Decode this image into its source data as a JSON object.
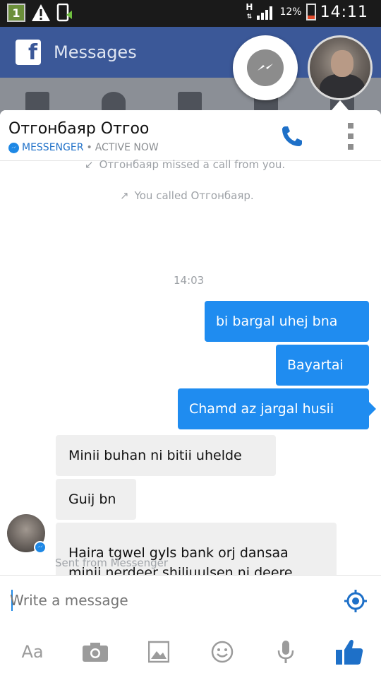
{
  "status_bar": {
    "notification_count": "1",
    "network_label": "H",
    "battery_percent": "12%",
    "time": "14:11"
  },
  "app_bar": {
    "title": "Messages"
  },
  "chat_header": {
    "contact_name": "Отгонбаяр Отгоо",
    "source_label": "MESSENGER",
    "separator": "•",
    "presence": "ACTIVE NOW"
  },
  "thread": {
    "system_messages": [
      {
        "text": "Отгонбаяр missed a call from you.",
        "icon": "missed-call-arrow-icon"
      },
      {
        "text": "You called Отгонбаяр.",
        "icon": "outgoing-call-arrow-icon"
      }
    ],
    "timestamp": "14:03",
    "outgoing": [
      {
        "text": "bi bargal uhej bna"
      },
      {
        "text": "Bayartai"
      },
      {
        "text": "Chamd az jargal husii"
      }
    ],
    "incoming": [
      {
        "text": "Minii buhan ni bitii uhelde"
      },
      {
        "text": "Guij bn"
      },
      {
        "text": "Haira tgwel gyls bank orj dansaa minii nerdeer shiljuulsen ni deere"
      }
    ],
    "sent_from": "Sent from Messenger"
  },
  "composer": {
    "placeholder": "Write a message",
    "text_button_label": "Aa"
  },
  "colors": {
    "accent": "#1f8cf0",
    "facebook_blue": "#3b5898",
    "incoming_bubble": "#efefef"
  }
}
